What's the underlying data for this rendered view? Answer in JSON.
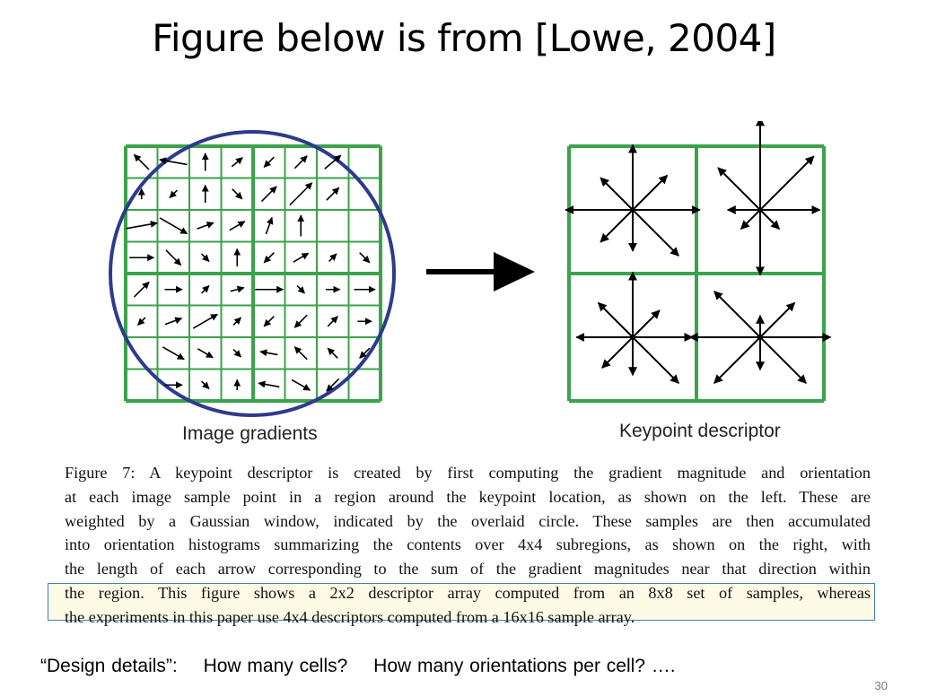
{
  "slide": {
    "title": "Figure below is from [Lowe, 2004]",
    "number": "30"
  },
  "figure": {
    "left_label": "Image gradients",
    "right_label": "Keypoint descriptor",
    "colors": {
      "grid": "#3ba34a",
      "circle": "#2e3a8c",
      "arrow": "#000000",
      "highlight_border": "#3f7fbf",
      "highlight_fill": "#fdfbe6"
    },
    "sample_grid": "8x8",
    "descriptor_array": "2x2"
  },
  "caption": {
    "lines": [
      "Figure 7: A keypoint descriptor is created by first computing the gradient magnitude and orientation",
      "at each image sample point in a region around the keypoint location, as shown on the left. These are",
      "weighted by a Gaussian window, indicated by the overlaid circle. These samples are then accumulated",
      "into orientation histograms summarizing the contents over 4x4 subregions, as shown on the right, with",
      "the length of each arrow corresponding to the sum of the gradient magnitudes near that direction within",
      "the region. This figure shows a 2x2 descriptor array computed from an 8x8 set of samples, whereas",
      "the experiments in this paper use 4x4 descriptors computed from a 16x16 sample array."
    ]
  },
  "questions": {
    "label": "“Design details”:",
    "q1": "How many cells?",
    "q2": "How many orientations per cell? …."
  }
}
